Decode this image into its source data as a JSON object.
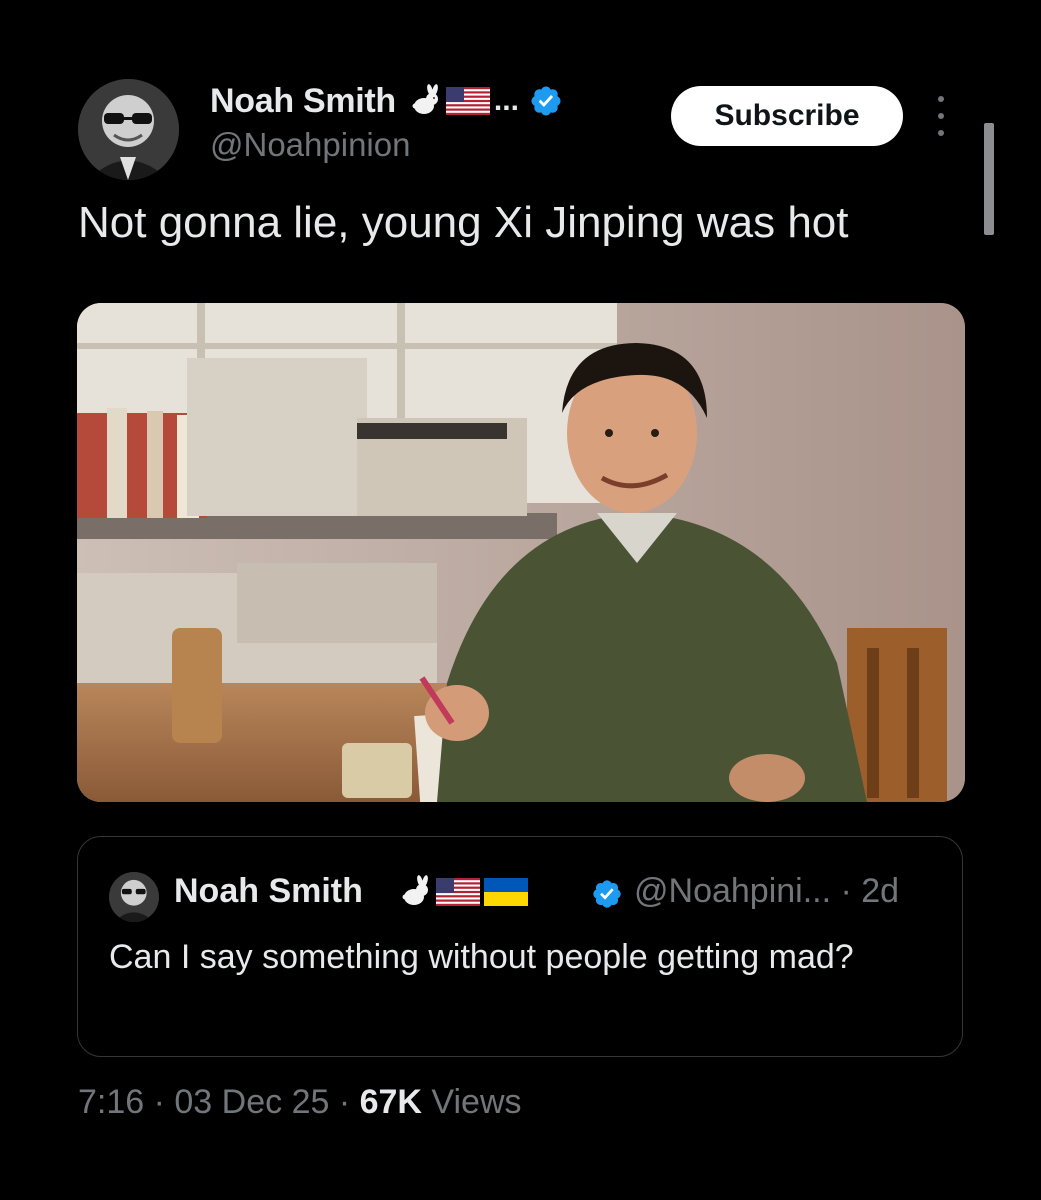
{
  "author": {
    "display_name": "Noah Smith",
    "handle": "@Noahpinion",
    "name_suffix": "...",
    "emojis": [
      "rabbit-emoji",
      "us-flag-emoji"
    ],
    "verified": true
  },
  "subscribe_label": "Subscribe",
  "tweet": {
    "text": "Not gonna lie, young Xi Jinping was hot"
  },
  "quote": {
    "display_name": "Noah Smith",
    "emojis": [
      "rabbit-emoji",
      "us-flag-emoji",
      "ukraine-flag-emoji"
    ],
    "handle_time": "@Noahpini... · 2d",
    "text": "Can I say something without people getting mad?"
  },
  "meta": {
    "time_date": "7:16 · 03 Dec 25 · ",
    "views_count": "67K",
    "views_label": " Views"
  },
  "colors": {
    "background": "#000000",
    "primary_text": "#e7e9ea",
    "secondary_text": "#71767b",
    "verified_blue": "#1d9bf0",
    "border": "#333639"
  }
}
